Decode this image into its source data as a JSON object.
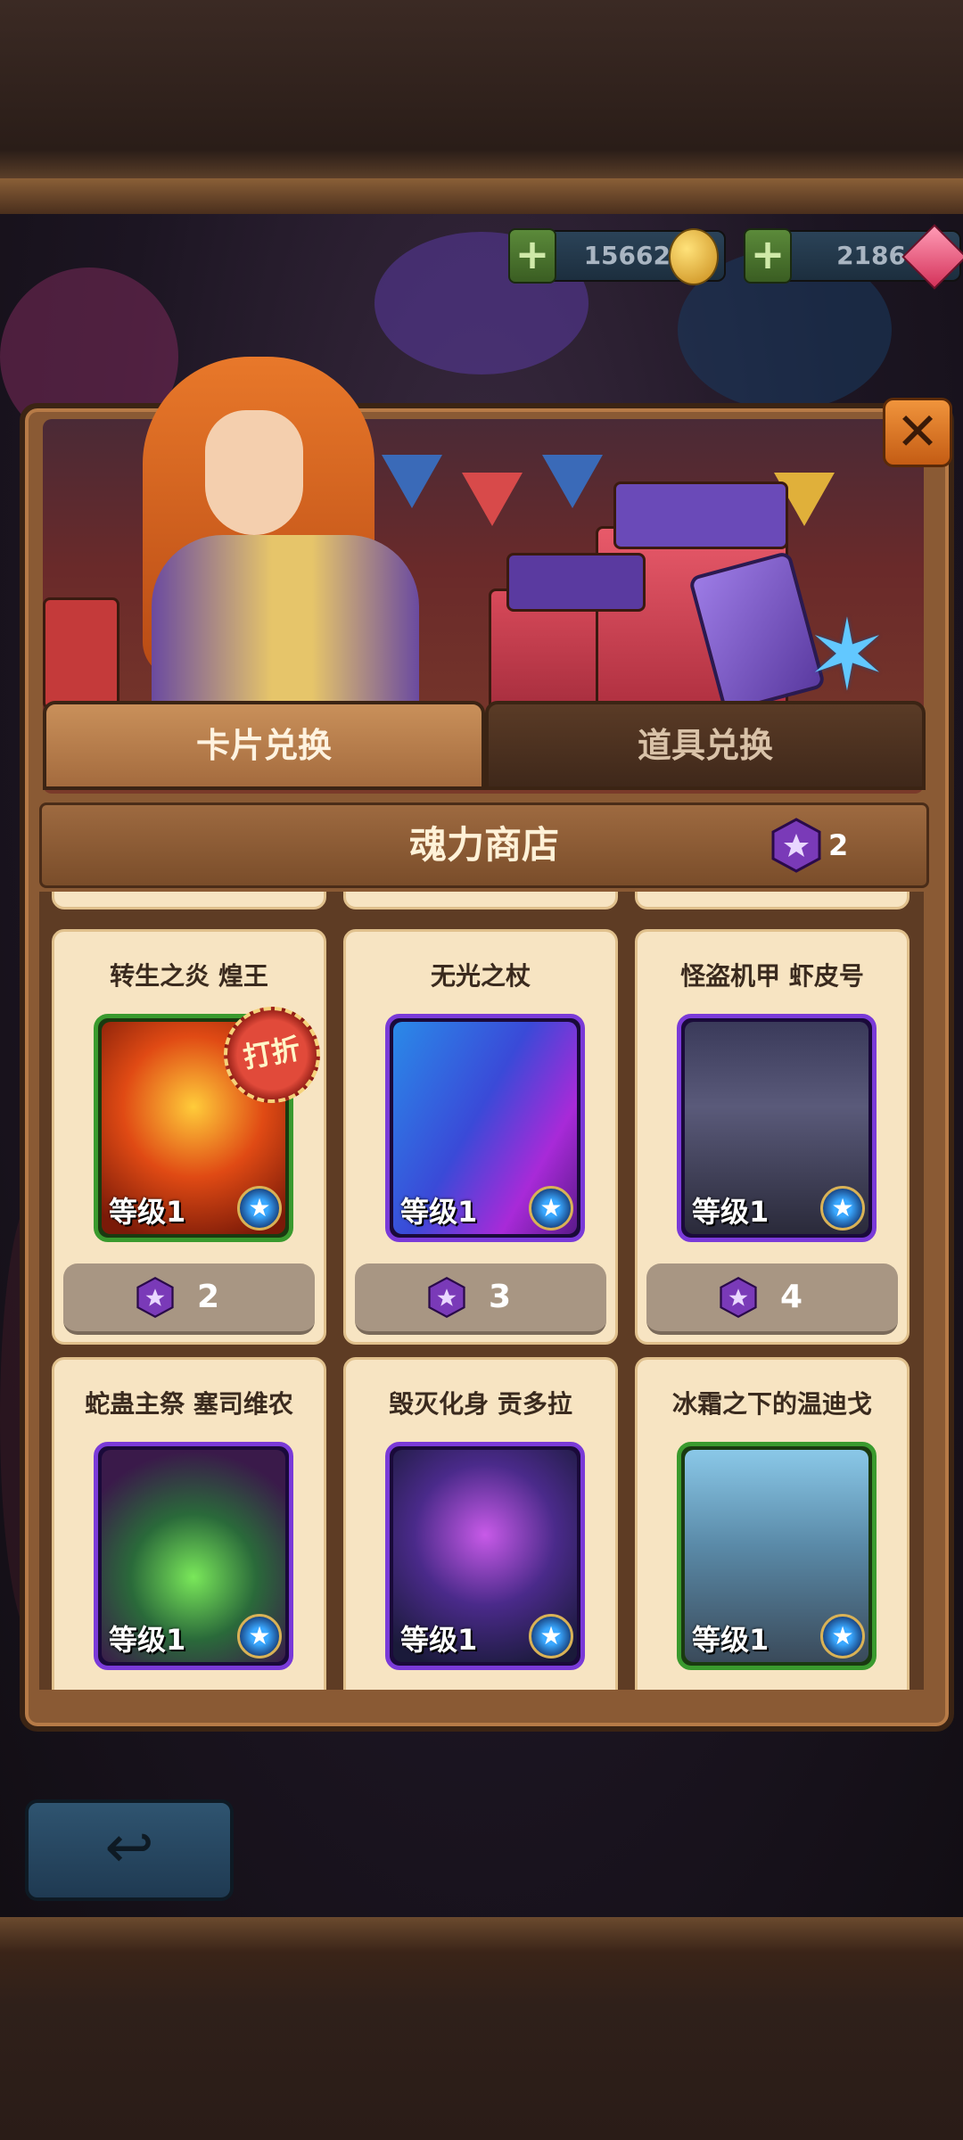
{
  "currency": {
    "gold": "15662",
    "gems": "2186",
    "add_gold_label": "+",
    "add_gems_label": "+"
  },
  "tabs": [
    {
      "label": "卡片兑换",
      "active": true
    },
    {
      "label": "道具兑换",
      "active": false
    }
  ],
  "shop": {
    "title": "魂力商店",
    "soul_points": "2"
  },
  "cards": [
    {
      "name": "转生之炎 煌王",
      "level": "等级1",
      "price": "2",
      "sale": "打折",
      "frame": "#3a9a2e",
      "art": "fire"
    },
    {
      "name": "无光之杖",
      "level": "等级1",
      "price": "3",
      "sale": "",
      "frame": "#7a3ad8",
      "art": "staff"
    },
    {
      "name": "怪盗机甲 虾皮号",
      "level": "等级1",
      "price": "4",
      "sale": "",
      "frame": "#7a3ad8",
      "art": "mech"
    },
    {
      "name": "蛇蛊主祭 塞司维农",
      "level": "等级1",
      "price": "",
      "sale": "",
      "frame": "#7a3ad8",
      "art": "snake"
    },
    {
      "name": "毁灭化身 贡多拉",
      "level": "等级1",
      "price": "",
      "sale": "",
      "frame": "#7a3ad8",
      "art": "dragon"
    },
    {
      "name": "冰霜之下的温迪戈",
      "level": "等级1",
      "price": "",
      "sale": "",
      "frame": "#3a9a2e",
      "art": "ice"
    }
  ],
  "close_label": "✕",
  "back_label": "↩",
  "colors": {
    "accent_orange": "#e07a2a",
    "panel_wood": "#8a5a34",
    "card_bg": "#f7e4c2",
    "epic_frame": "#7a3ad8",
    "rare_frame": "#3a9a2e"
  }
}
